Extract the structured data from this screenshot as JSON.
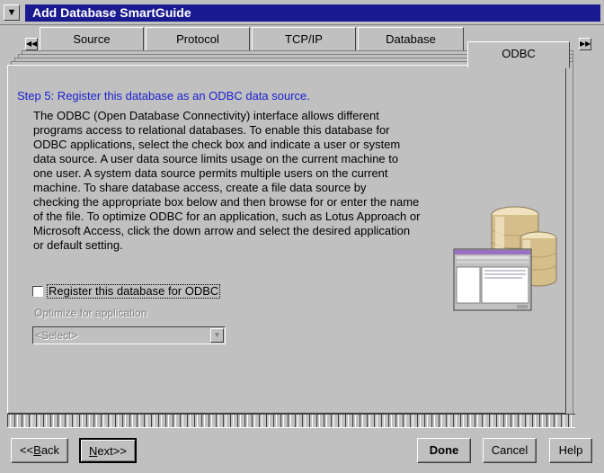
{
  "window": {
    "title": "Add Database SmartGuide"
  },
  "tabs": [
    {
      "label": "Source"
    },
    {
      "label": "Protocol"
    },
    {
      "label": "TCP/IP"
    },
    {
      "label": "Database"
    },
    {
      "label": "ODBC"
    }
  ],
  "page": {
    "step": "Step 5: Register this database as an ODBC data source.",
    "description_lines": [
      "The ODBC (Open Database Connectivity) interface allows different",
      "programs access to relational databases. To enable this database for",
      "ODBC applications, select the check box and indicate a user or system",
      "data source.  A user data source limits usage on the current machine to",
      "one user. A system data source permits multiple users on the current",
      "machine.  To share database access, create a file data source by",
      "checking the appropriate box below and then browse for or enter the name",
      "of the file.  To optimize ODBC for an application, such as Lotus Approach or",
      "Microsoft Access, click the down arrow and select the desired application",
      "or default setting."
    ],
    "register_checkbox": {
      "label": "Register this database for ODBC",
      "checked": false
    },
    "optimize_label": "Optimize for application",
    "optimize_select": {
      "value": "<Select>"
    }
  },
  "buttons": {
    "back": {
      "prefix": "<<",
      "accel": "B",
      "rest": "ack"
    },
    "next": {
      "accel": "N",
      "rest": "ext>>"
    },
    "done": "Done",
    "cancel": "Cancel",
    "help": "Help"
  }
}
